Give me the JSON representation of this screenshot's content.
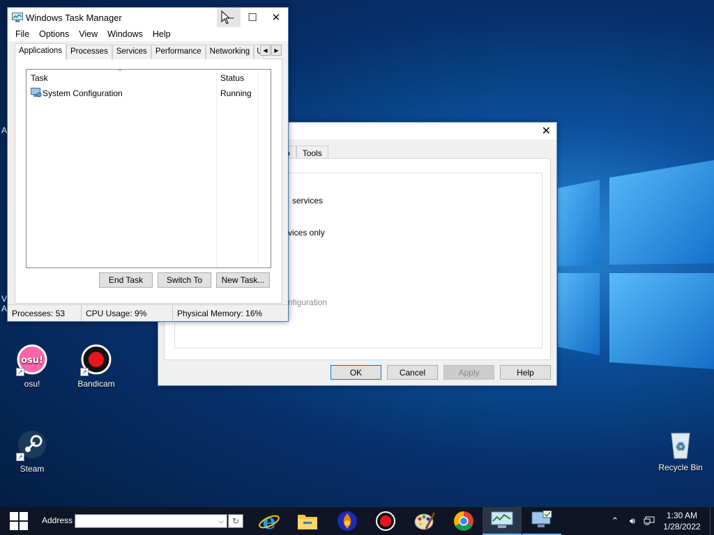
{
  "desktop": {
    "icons": [
      {
        "label": "osu!"
      },
      {
        "label": "Bandicam"
      },
      {
        "label": "Steam"
      },
      {
        "label": "Recycle Bin"
      }
    ],
    "edge_letters": [
      "A",
      "V",
      "A"
    ]
  },
  "task_manager": {
    "title": "Windows Task Manager",
    "menu": [
      "File",
      "Options",
      "View",
      "Windows",
      "Help"
    ],
    "tabs": [
      "Applications",
      "Processes",
      "Services",
      "Performance",
      "Networking",
      "U"
    ],
    "columns": {
      "task": "Task",
      "status": "Status"
    },
    "rows": [
      {
        "task": "System Configuration",
        "status": "Running"
      }
    ],
    "buttons": {
      "end_task": "End Task",
      "switch_to": "Switch To",
      "new_task": "New Task..."
    },
    "status": {
      "processes": "Processes: 53",
      "cpu": "CPU Usage: 9%",
      "memory": "Physical Memory: 16%"
    }
  },
  "sys_config": {
    "tabs": [
      "tup",
      "Tools"
    ],
    "texts": [
      "services",
      "vices only",
      "nfiguration"
    ],
    "buttons": {
      "ok": "OK",
      "cancel": "Cancel",
      "apply": "Apply",
      "help": "Help"
    }
  },
  "taskbar": {
    "address_label": "Address",
    "address_value": "",
    "apps": [
      "internet-explorer",
      "file-explorer",
      "app-orange",
      "bandicam",
      "paint",
      "chrome",
      "task-manager",
      "system-config"
    ],
    "clock": {
      "time": "1:30 AM",
      "date": "1/28/2022"
    }
  }
}
